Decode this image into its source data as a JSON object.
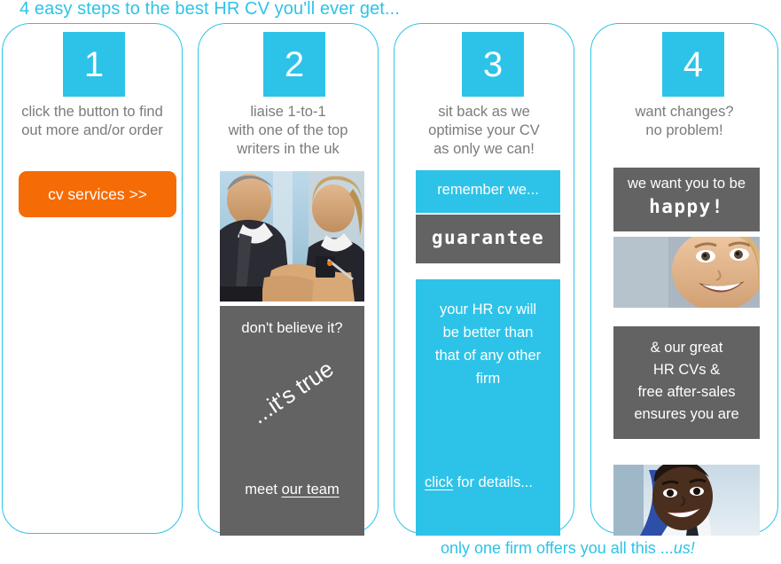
{
  "headline": "4 easy steps to the best HR CV you'll ever get...",
  "footer": {
    "text": "only one firm offers you all this ...",
    "emphasis": "us!"
  },
  "colors": {
    "cyan": "#2dc3e8",
    "orange": "#f56b05",
    "grey": "#636363",
    "caption_grey": "#7b7b7b"
  },
  "steps": [
    {
      "number": "1",
      "caption": "click the button to find\nout more and/or order",
      "cta_label": "cv services >>"
    },
    {
      "number": "2",
      "caption": "liaise 1-to-1\nwith one of the top\nwriters in the uk",
      "photo_alt": "two-business-people-photo",
      "panel": {
        "line1": "don't believe it?",
        "rotated": "...it's true",
        "line3_prefix": "meet ",
        "line3_link": "our team"
      }
    },
    {
      "number": "3",
      "caption": "sit back as we\noptimise your CV\nas only we can!",
      "panel_cyan_top": "remember we...",
      "panel_grey": "guarantee",
      "panel_cyan_body": "your HR cv will\nbe better than\nthat of any other\nfirm",
      "panel_cyan_link": "click",
      "panel_cyan_link_suffix": " for details..."
    },
    {
      "number": "4",
      "caption": "want changes?\nno problem!",
      "panel_top_line1": "we want you to be",
      "panel_top_line2": "happy!",
      "photo1_alt": "smiling-woman-photo",
      "panel_bottom": "& our great\nHR CVs &\nfree after-sales\nensures you are",
      "photo2_alt": "smiling-man-photo"
    }
  ]
}
